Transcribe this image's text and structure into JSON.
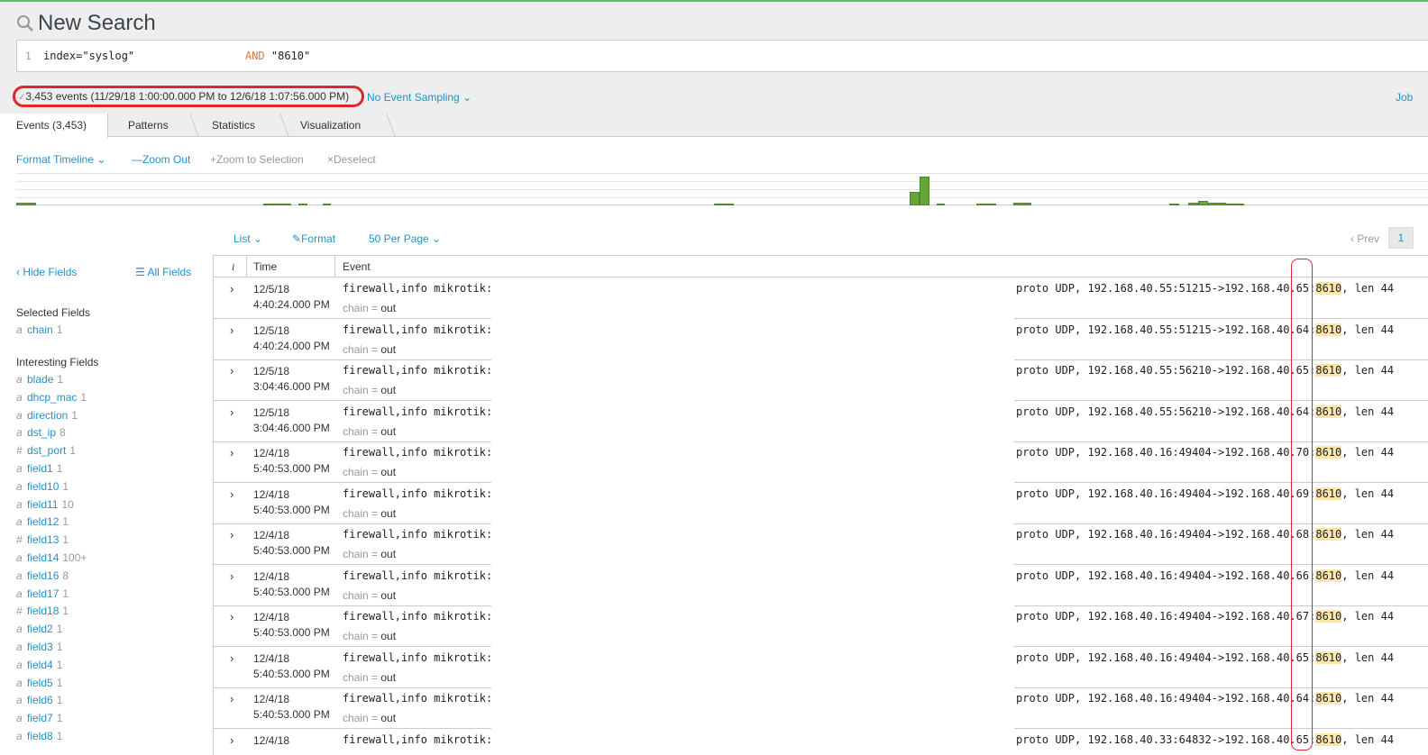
{
  "header": {
    "title": "New Search",
    "search_icon": "search-icon",
    "line_number": "1",
    "query_part1": "index=\"syslog\"                 ",
    "query_op": "AND",
    "query_part2": " \"8610\""
  },
  "summary": {
    "events": "3,453 events (11/29/18 1:00:00.000 PM to 12/6/18 1:07:56.000 PM)",
    "sampling": "No Event Sampling",
    "job": "Job",
    "highlight_color": "#e2242c"
  },
  "tabs": [
    {
      "label": "Events (3,453)",
      "active": true
    },
    {
      "label": "Patterns"
    },
    {
      "label": "Statistics"
    },
    {
      "label": "Visualization"
    }
  ],
  "timeline_toolbar": {
    "format_timeline": "Format Timeline",
    "zoom_out": "Zoom Out",
    "zoom_to_selection": "Zoom to Selection",
    "deselect": "Deselect"
  },
  "timeline_bars": [
    {
      "pos": 0.0,
      "w": 0.014,
      "level": 0.08
    },
    {
      "pos": 0.175,
      "w": 0.02,
      "level": 0.06
    },
    {
      "pos": 0.2,
      "w": 0.006,
      "level": 0.06
    },
    {
      "pos": 0.217,
      "w": 0.006,
      "level": 0.06
    },
    {
      "pos": 0.494,
      "w": 0.014,
      "level": 0.06
    },
    {
      "pos": 0.633,
      "w": 0.007,
      "level": 0.45
    },
    {
      "pos": 0.64,
      "w": 0.007,
      "level": 0.95
    },
    {
      "pos": 0.652,
      "w": 0.006,
      "level": 0.06
    },
    {
      "pos": 0.68,
      "w": 0.014,
      "level": 0.06
    },
    {
      "pos": 0.706,
      "w": 0.013,
      "level": 0.08
    },
    {
      "pos": 0.817,
      "w": 0.007,
      "level": 0.05
    },
    {
      "pos": 0.83,
      "w": 0.007,
      "level": 0.1
    },
    {
      "pos": 0.837,
      "w": 0.007,
      "level": 0.15
    },
    {
      "pos": 0.844,
      "w": 0.006,
      "level": 0.08
    },
    {
      "pos": 0.85,
      "w": 0.007,
      "level": 0.1
    },
    {
      "pos": 0.857,
      "w": 0.013,
      "level": 0.06
    }
  ],
  "list_toolbar": {
    "list": "List",
    "format": "Format",
    "per_page": "50 Per Page",
    "prev": "Prev",
    "page": "1"
  },
  "sidebar": {
    "hide_fields": "Hide Fields",
    "all_fields": "All Fields",
    "selected_title": "Selected Fields",
    "selected": [
      {
        "type": "a",
        "name": "chain",
        "count": "1"
      }
    ],
    "interesting_title": "Interesting Fields",
    "interesting": [
      {
        "type": "a",
        "name": "blade",
        "count": "1"
      },
      {
        "type": "a",
        "name": "dhcp_mac",
        "count": "1"
      },
      {
        "type": "a",
        "name": "direction",
        "count": "1"
      },
      {
        "type": "a",
        "name": "dst_ip",
        "count": "8"
      },
      {
        "type": "#",
        "name": "dst_port",
        "count": "1"
      },
      {
        "type": "a",
        "name": "field1",
        "count": "1"
      },
      {
        "type": "a",
        "name": "field10",
        "count": "1"
      },
      {
        "type": "a",
        "name": "field11",
        "count": "10"
      },
      {
        "type": "a",
        "name": "field12",
        "count": "1"
      },
      {
        "type": "#",
        "name": "field13",
        "count": "1"
      },
      {
        "type": "a",
        "name": "field14",
        "count": "100+"
      },
      {
        "type": "a",
        "name": "field16",
        "count": "8"
      },
      {
        "type": "a",
        "name": "field17",
        "count": "1"
      },
      {
        "type": "#",
        "name": "field18",
        "count": "1"
      },
      {
        "type": "a",
        "name": "field2",
        "count": "1"
      },
      {
        "type": "a",
        "name": "field3",
        "count": "1"
      },
      {
        "type": "a",
        "name": "field4",
        "count": "1"
      },
      {
        "type": "a",
        "name": "field5",
        "count": "1"
      },
      {
        "type": "a",
        "name": "field6",
        "count": "1"
      },
      {
        "type": "a",
        "name": "field7",
        "count": "1"
      },
      {
        "type": "a",
        "name": "field8",
        "count": "1"
      }
    ]
  },
  "table": {
    "col_i": "i",
    "col_time": "Time",
    "col_event": "Event",
    "chain_key": "chain",
    "chain_eq": " = ",
    "rows": [
      {
        "date": "12/5/18",
        "time": "4:40:24.000 PM",
        "head": "firewall,info mikrotik:",
        "tail_pre": "proto UDP, 192.168.40.55:51215->192.168.40.65:",
        "port": "8610",
        "tail_post": ", len 44",
        "chain": "out"
      },
      {
        "date": "12/5/18",
        "time": "4:40:24.000 PM",
        "head": "firewall,info mikrotik:",
        "tail_pre": "proto UDP, 192.168.40.55:51215->192.168.40.64:",
        "port": "8610",
        "tail_post": ", len 44",
        "chain": "out"
      },
      {
        "date": "12/5/18",
        "time": "3:04:46.000 PM",
        "head": "firewall,info mikrotik:",
        "tail_pre": "proto UDP, 192.168.40.55:56210->192.168.40.65:",
        "port": "8610",
        "tail_post": ", len 44",
        "chain": "out"
      },
      {
        "date": "12/5/18",
        "time": "3:04:46.000 PM",
        "head": "firewall,info mikrotik:",
        "tail_pre": "proto UDP, 192.168.40.55:56210->192.168.40.64:",
        "port": "8610",
        "tail_post": ", len 44",
        "chain": "out"
      },
      {
        "date": "12/4/18",
        "time": "5:40:53.000 PM",
        "head": "firewall,info mikrotik:",
        "tail_pre": "proto UDP, 192.168.40.16:49404->192.168.40.70:",
        "port": "8610",
        "tail_post": ", len 44",
        "chain": "out"
      },
      {
        "date": "12/4/18",
        "time": "5:40:53.000 PM",
        "head": "firewall,info mikrotik:",
        "tail_pre": "proto UDP, 192.168.40.16:49404->192.168.40.69:",
        "port": "8610",
        "tail_post": ", len 44",
        "chain": "out"
      },
      {
        "date": "12/4/18",
        "time": "5:40:53.000 PM",
        "head": "firewall,info mikrotik:",
        "tail_pre": "proto UDP, 192.168.40.16:49404->192.168.40.68:",
        "port": "8610",
        "tail_post": ", len 44",
        "chain": "out"
      },
      {
        "date": "12/4/18",
        "time": "5:40:53.000 PM",
        "head": "firewall,info mikrotik:",
        "tail_pre": "proto UDP, 192.168.40.16:49404->192.168.40.66:",
        "port": "8610",
        "tail_post": ", len 44",
        "chain": "out"
      },
      {
        "date": "12/4/18",
        "time": "5:40:53.000 PM",
        "head": "firewall,info mikrotik:",
        "tail_pre": "proto UDP, 192.168.40.16:49404->192.168.40.67:",
        "port": "8610",
        "tail_post": ", len 44",
        "chain": "out"
      },
      {
        "date": "12/4/18",
        "time": "5:40:53.000 PM",
        "head": "firewall,info mikrotik:",
        "tail_pre": "proto UDP, 192.168.40.16:49404->192.168.40.65:",
        "port": "8610",
        "tail_post": ", len 44",
        "chain": "out"
      },
      {
        "date": "12/4/18",
        "time": "5:40:53.000 PM",
        "head": "firewall,info mikrotik:",
        "tail_pre": "proto UDP, 192.168.40.16:49404->192.168.40.64:",
        "port": "8610",
        "tail_post": ", len 44",
        "chain": "out"
      },
      {
        "date": "12/4/18",
        "time": "",
        "head": "firewall,info mikrotik:",
        "tail_pre": "proto UDP, 192.168.40.33:64832->192.168.40.65:",
        "port": "8610",
        "tail_post": ", len 44",
        "chain": ""
      }
    ]
  },
  "colors": {
    "link": "#1e93c6",
    "bar": "#65a637",
    "highlight": "#fde5ac",
    "annotation": "#e2242c"
  }
}
